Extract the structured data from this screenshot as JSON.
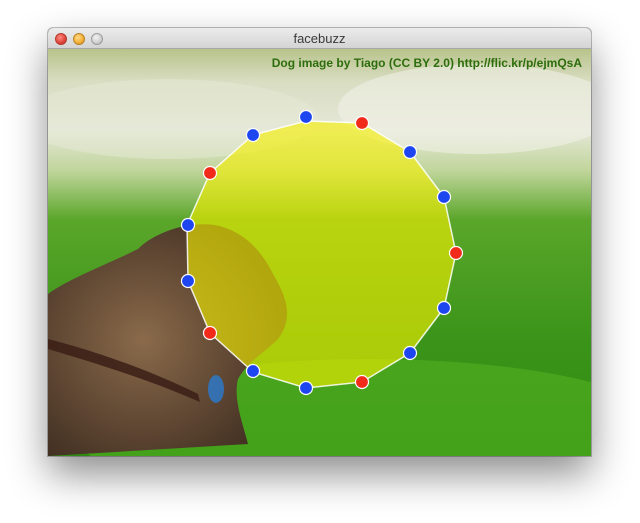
{
  "window": {
    "title": "facebuzz"
  },
  "photo": {
    "credit": "Dog image by Tiago (CC BY 2.0) http://flic.kr/p/ejmQsA"
  },
  "overlay": {
    "fill_color": "#f4ef00",
    "outline_color": "#ffffff",
    "control_points": [
      {
        "color": "blue"
      },
      {
        "color": "red"
      },
      {
        "color": "blue"
      },
      {
        "color": "blue"
      },
      {
        "color": "red"
      },
      {
        "color": "blue"
      },
      {
        "color": "blue"
      },
      {
        "color": "red"
      },
      {
        "color": "blue"
      },
      {
        "color": "blue"
      },
      {
        "color": "red"
      },
      {
        "color": "blue"
      },
      {
        "color": "blue"
      },
      {
        "color": "red"
      },
      {
        "color": "blue"
      }
    ]
  },
  "colors": {
    "point_red": "#f12a1a",
    "point_blue": "#1e46f0",
    "grass": "#3c9a14"
  }
}
